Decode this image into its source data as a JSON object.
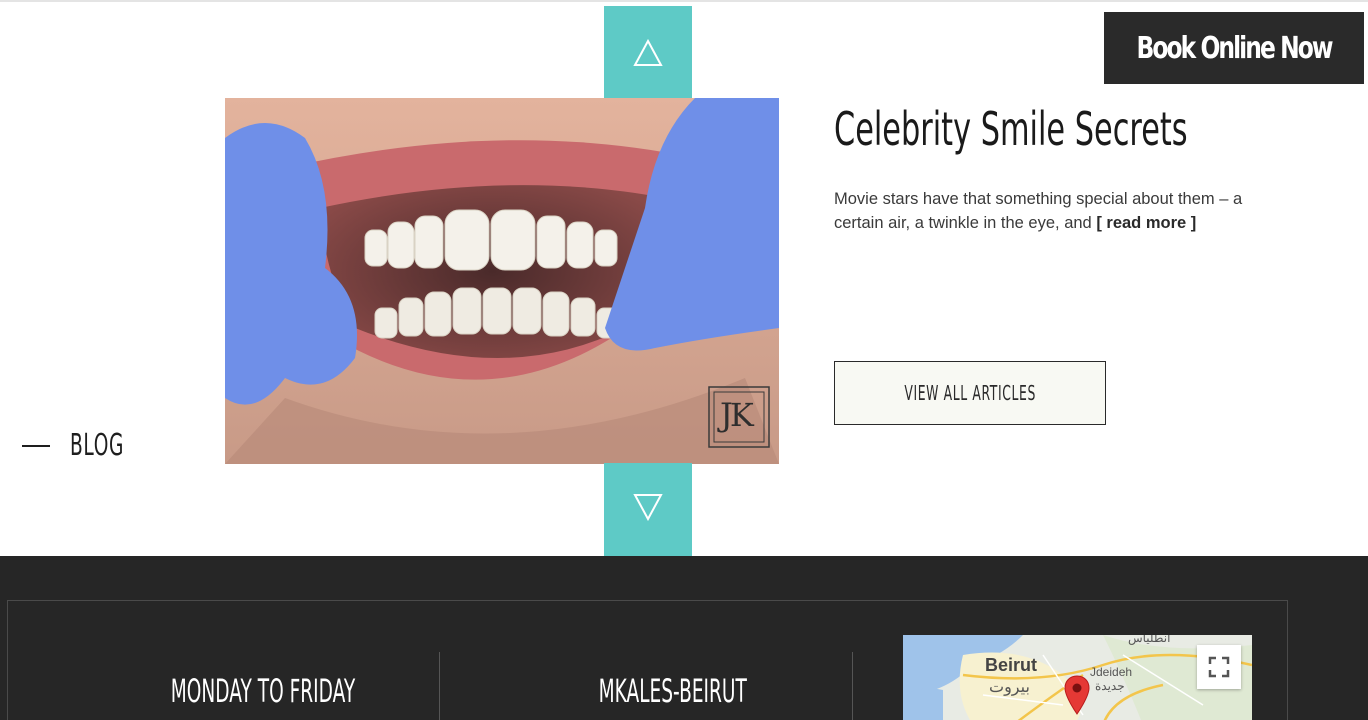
{
  "header": {
    "book_button_label": "Book Online Now"
  },
  "carousel": {
    "up_icon": "triangle-up-icon",
    "down_icon": "triangle-down-icon",
    "accent_color": "#5ecac6"
  },
  "section_label": "BLOG",
  "post": {
    "title": "Celebrity Smile Secrets",
    "excerpt": "Movie stars have that something special about them – a certain air, a twinkle in the eye, and",
    "read_more": "[ read more ]",
    "watermark": "JK"
  },
  "view_all_label": "VIEW ALL ARTICLES",
  "footer": {
    "hours_heading": "MONDAY TO FRIDAY",
    "location_heading": "MKALES-BEIRUT",
    "map": {
      "city_en": "Beirut",
      "city_ar": "بيروت",
      "suburb_en": "Jdeideh",
      "suburb_ar": "جديدة",
      "top_ar": "انطلياس",
      "fullscreen_icon": "fullscreen-icon",
      "pin_icon": "map-pin-icon"
    }
  }
}
